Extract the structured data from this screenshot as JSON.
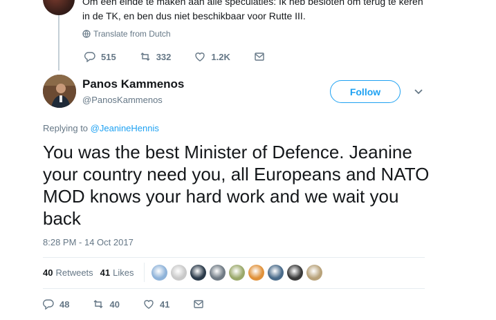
{
  "previous_tweet": {
    "text": "Om een einde te maken aan alle speculaties: Ik heb besloten om terug te keren in de TK, en ben dus niet beschikbaar voor Rutte III.",
    "translate_label": "Translate from Dutch",
    "actions": {
      "replies": "515",
      "retweets": "332",
      "likes": "1.2K"
    }
  },
  "tweet": {
    "author_name": "Panos Kammenos",
    "author_handle": "@PanosKammenos",
    "follow_label": "Follow",
    "replying_prefix": "Replying to",
    "replying_to": "@JeanineHennis",
    "text": "You was the best Minister of Defence. Jeanine your country need you, all Europeans and NATO MOD knows your hard work and we wait you back",
    "timestamp": "8:28 PM - 14 Oct 2017",
    "retweets_count": "40",
    "retweets_label": "Retweets",
    "likes_count": "41",
    "likes_label": "Likes",
    "liker_colors": [
      "#8fb3d9",
      "#c9c9c9",
      "#2b3a4a",
      "#6f7a84",
      "#9aa86a",
      "#e0913a",
      "#4a6b8a",
      "#3a3a3a",
      "#b8a27a"
    ],
    "actions": {
      "replies": "48",
      "retweets": "40",
      "likes": "41"
    }
  },
  "colors": {
    "accent": "#1da1f2",
    "muted": "#657786",
    "text": "#14171a"
  }
}
